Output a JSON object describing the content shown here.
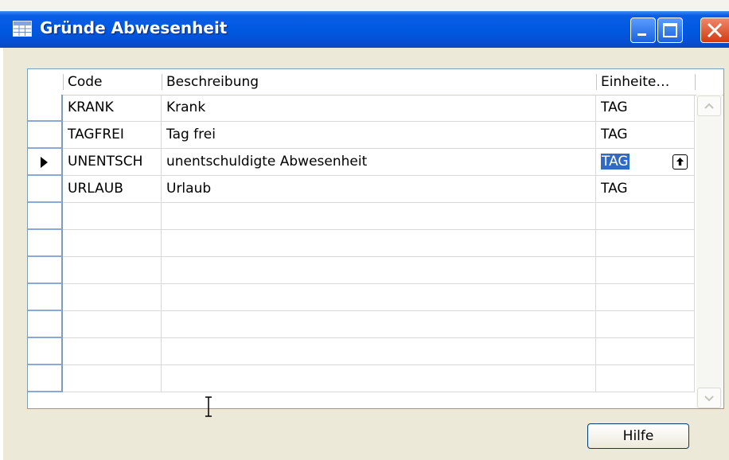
{
  "window": {
    "title": "Gründe Abwesenheit",
    "icons": {
      "app": "table-form-icon",
      "minimize": "minimize-icon",
      "maximize": "maximize-icon",
      "close": "close-icon"
    }
  },
  "grid": {
    "columns": [
      "Code",
      "Beschreibung",
      "Einheite…"
    ],
    "rows": [
      {
        "code": "KRANK",
        "description": "Krank",
        "unit": "TAG"
      },
      {
        "code": "TAGFREI",
        "description": "Tag frei",
        "unit": "TAG"
      },
      {
        "code": "UNENTSCH",
        "description": "unentschuldigte Abwesenheit",
        "unit": "TAG"
      },
      {
        "code": "URLAUB",
        "description": "Urlaub",
        "unit": "TAG"
      }
    ],
    "current_row": 2,
    "lookup_icon": "lookup-arrow-icon"
  },
  "buttons": {
    "help": "Hilfe"
  },
  "colors": {
    "title_blue": "#0058e0",
    "selection": "#316ac5",
    "face": "#ece9d8"
  }
}
